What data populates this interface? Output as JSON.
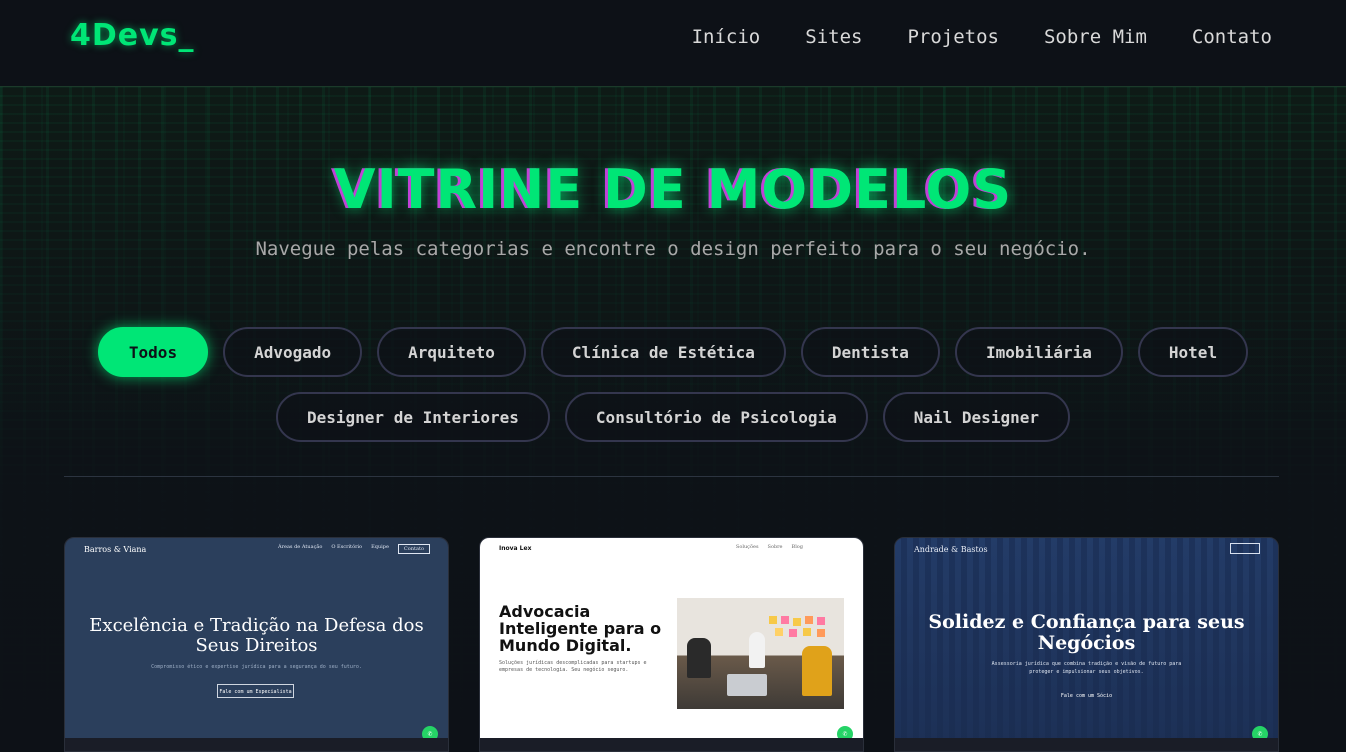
{
  "header": {
    "logo": "4Devs_",
    "nav": [
      "Início",
      "Sites",
      "Projetos",
      "Sobre Mim",
      "Contato"
    ]
  },
  "hero": {
    "title": "VITRINE DE MODELOS",
    "subtitle": "Navegue pelas categorias e encontre o design perfeito para o seu negócio."
  },
  "filters": {
    "active": "Todos",
    "items": [
      "Todos",
      "Advogado",
      "Arquiteto",
      "Clínica de Estética",
      "Dentista",
      "Imobiliária",
      "Hotel",
      "Designer de Interiores",
      "Consultório de Psicologia",
      "Nail Designer"
    ]
  },
  "cards": [
    {
      "brand": "Barros & Viana",
      "links": [
        "Áreas de Atuação",
        "O Escritório",
        "Equipe"
      ],
      "nav_button": "Contato",
      "headline": "Excelência e Tradição na Defesa dos Seus Direitos",
      "tagline": "Compromisso ético e expertise jurídica para a segurança do seu futuro.",
      "cta": "Fale com um Especialista"
    },
    {
      "brand": "Inova Lex",
      "links": [
        "Soluções",
        "Sobre",
        "Blog"
      ],
      "headline": "Advocacia Inteligente para o Mundo Digital.",
      "tagline": "Soluções jurídicas descomplicadas para startups e empresas de tecnologia. Seu negócio seguro."
    },
    {
      "brand": "Andrade & Bastos",
      "headline": "Solidez e Confiança para seus Negócios",
      "tagline": "Assessoria jurídica que combina tradição e visão de futuro para proteger e impulsionar seus objetivos.",
      "cta": "Fale com um Sócio"
    }
  ],
  "colors": {
    "accent": "#00e676",
    "background": "#0d1117",
    "title_shadow": "#c042d6",
    "whatsapp": "#25d366"
  }
}
